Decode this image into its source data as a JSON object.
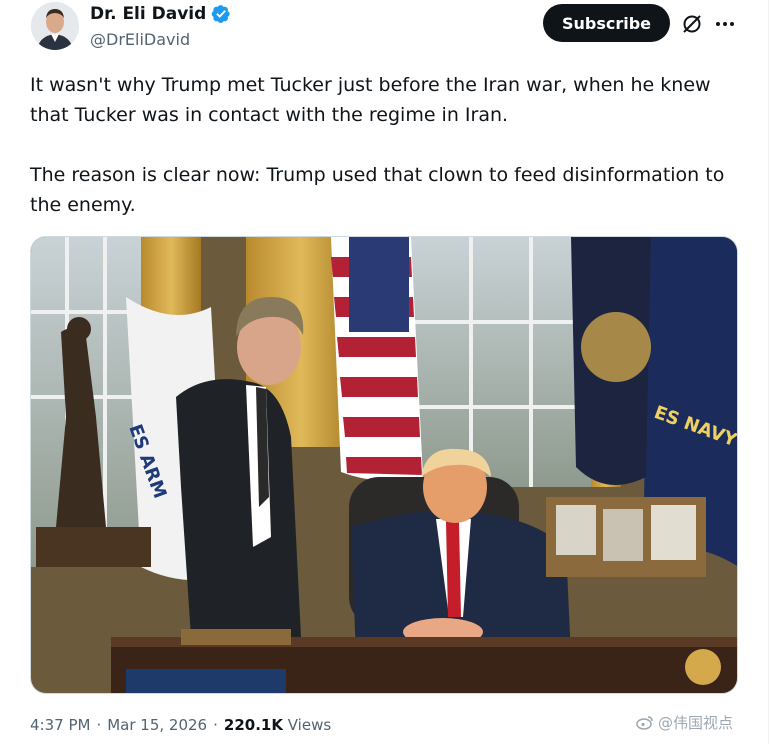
{
  "author": {
    "display_name": "Dr. Eli David",
    "handle": "@DrEliDavid",
    "verified": true,
    "avatar": "author-avatar"
  },
  "actions": {
    "subscribe_label": "Subscribe",
    "grok_icon": "grok-slash-icon",
    "more_icon": "more-dots-icon"
  },
  "post": {
    "paragraph_1": "It wasn't why Trump met Tucker just before the Iran war, when he knew that Tucker was in contact with the regime in Iran.",
    "paragraph_2": "The reason is clear now: Trump used that clown to feed disinformation to the enemy."
  },
  "media": {
    "kind": "photo",
    "flag_text_left": "ES ARM",
    "flag_text_right": "ES NAVY"
  },
  "meta": {
    "time": "4:37 PM",
    "date": "Mar 15, 2026",
    "separator": "·",
    "views_count": "220.1K",
    "views_label": "Views"
  },
  "watermark": {
    "text": "@伟国视点",
    "icon": "weibo-logo-icon"
  },
  "colors": {
    "accent": "#1d9bf0",
    "text_primary": "#0f1419",
    "text_secondary": "#536471",
    "button_dark": "#0f1419"
  }
}
